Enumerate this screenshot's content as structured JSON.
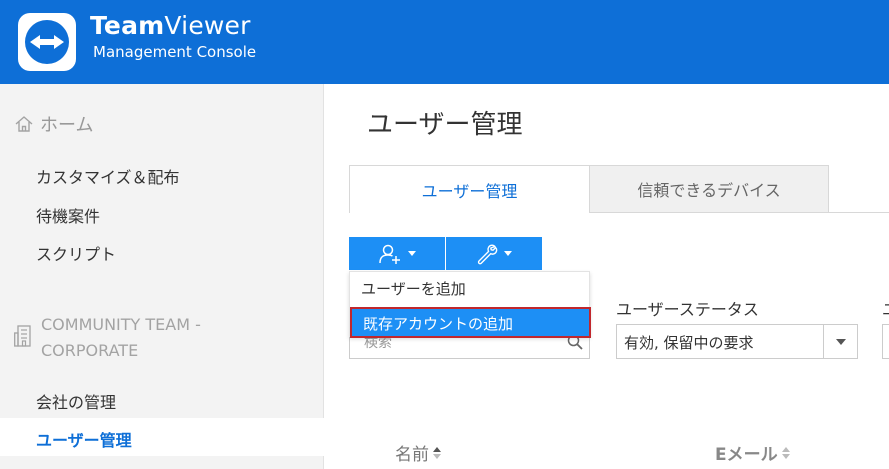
{
  "header": {
    "brand_bold": "Team",
    "brand_light": "Viewer",
    "subtitle": "Management Console",
    "logo_icon": "teamviewer-logo-icon",
    "color": "#0e6fd7"
  },
  "sidebar": {
    "home_label": "ホーム",
    "items": [
      {
        "label": "カスタマイズ＆配布"
      },
      {
        "label": "待機案件"
      },
      {
        "label": "スクリプト"
      }
    ],
    "group": {
      "line1": "COMMUNITY TEAM -",
      "line2": "CORPORATE"
    },
    "company_label": "会社の管理",
    "active_label": "ユーザー管理",
    "active_color": "#0e6fd7"
  },
  "main": {
    "title": "ユーザー管理",
    "tabs": [
      {
        "label": "ユーザー管理",
        "active": true
      },
      {
        "label": "信頼できるデバイス",
        "active": false
      }
    ],
    "toolbar": {
      "add_icon": "add-user-icon",
      "tools_icon": "wrench-icon",
      "button_color": "#1d8ff5"
    },
    "dropdown": {
      "items": [
        {
          "label": "ユーザーを追加"
        },
        {
          "label": "既存アカウントの追加",
          "highlighted": true
        }
      ],
      "highlight_border": "#c1272d"
    },
    "search": {
      "placeholder": "検索"
    },
    "status_filter": {
      "label": "ユーザーステータス",
      "value": "有効, 保留中の要求"
    },
    "cut_label": "ユ",
    "columns": [
      {
        "label": "名前"
      },
      {
        "label": "Eメール"
      }
    ]
  }
}
